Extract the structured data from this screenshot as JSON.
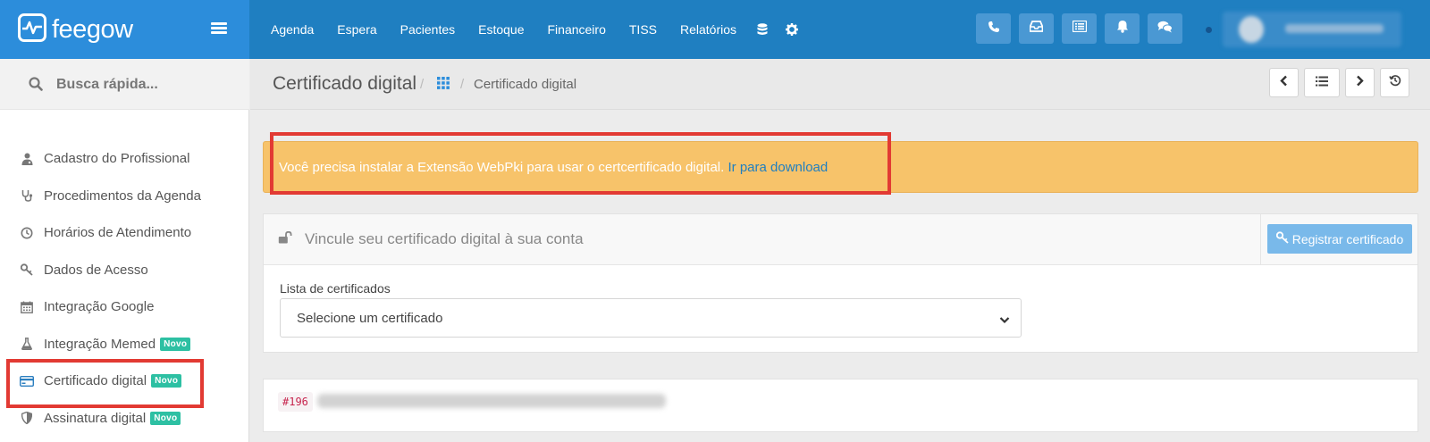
{
  "brand": {
    "name": "feegow"
  },
  "topnav": {
    "items": [
      "Agenda",
      "Espera",
      "Pacientes",
      "Estoque",
      "Financeiro",
      "TISS",
      "Relatórios"
    ],
    "icons": [
      "database-icon",
      "gear-icon"
    ]
  },
  "toolbar_icons": [
    "phone-icon",
    "inbox-icon",
    "list-alt-icon",
    "bell-icon",
    "chat-icon"
  ],
  "sidebar": {
    "search_label": "Busca rápida...",
    "items": [
      {
        "label": "Cadastro do Profissional",
        "icon": "user-doctor-icon",
        "badge": ""
      },
      {
        "label": "Procedimentos da Agenda",
        "icon": "stethoscope-icon",
        "badge": ""
      },
      {
        "label": "Horários de Atendimento",
        "icon": "clock-icon",
        "badge": ""
      },
      {
        "label": "Dados de Acesso",
        "icon": "key-icon",
        "badge": ""
      },
      {
        "label": "Integração Google",
        "icon": "calendar-icon",
        "badge": ""
      },
      {
        "label": "Integração Memed",
        "icon": "flask-icon",
        "badge": "Novo"
      },
      {
        "label": "Certificado digital",
        "icon": "credit-card-icon",
        "badge": "Novo"
      },
      {
        "label": "Assinatura digital",
        "icon": "shield-icon",
        "badge": "Novo"
      }
    ]
  },
  "header": {
    "title": "Certificado digital",
    "breadcrumb_current": "Certificado digital",
    "buttons": [
      "chevron-left-icon",
      "list-icon",
      "chevron-right-icon",
      "history-icon"
    ]
  },
  "alert": {
    "text": "Você precisa instalar a Extensão WebPki para usar o certcertificado digital.",
    "link": "Ir para download",
    "color": "#f7c36a"
  },
  "panel": {
    "title": "Vincule seu certificado digital à sua conta",
    "register_button": "Registrar certificado",
    "field_label": "Lista de certificados",
    "select_value": "Selecione um certificado"
  },
  "card": {
    "code": "#196"
  },
  "colors": {
    "topbar": "#1f7fc1",
    "brand": "#2c8ddb",
    "badge": "#2dc0a3",
    "highlight": "#e23a33"
  }
}
